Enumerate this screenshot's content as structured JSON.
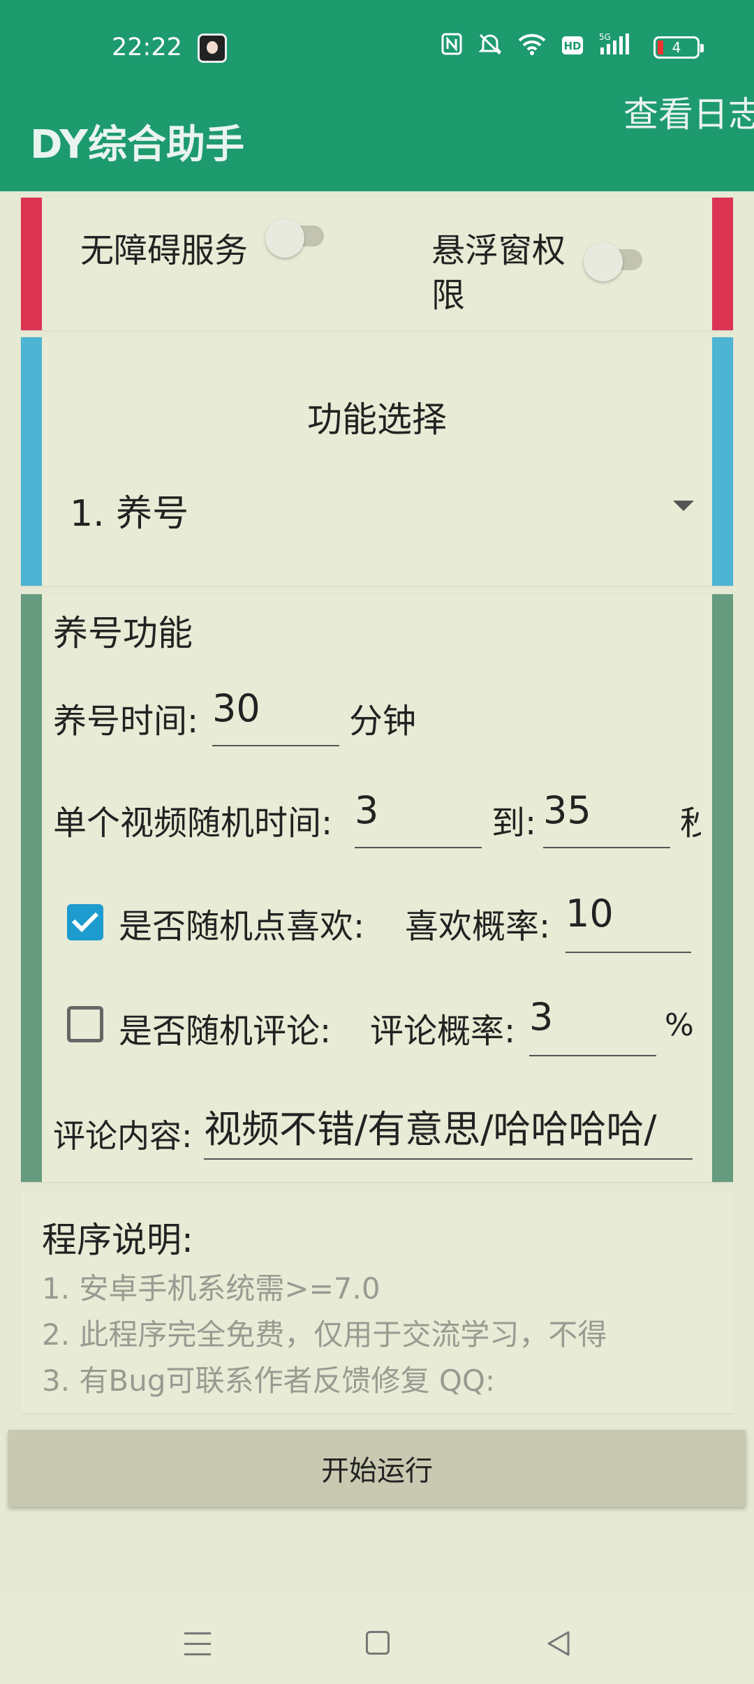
{
  "status_bar": {
    "time": "22:22",
    "icons": [
      "nfc-icon",
      "mute-icon",
      "wifi-icon",
      "hd-icon",
      "signal-5g-icon"
    ],
    "battery": "4"
  },
  "app_bar": {
    "title": "DY综合助手",
    "log_button": "查看日志"
  },
  "colors": {
    "primary": "#1e9a6f",
    "permission_accent": "#dc3352",
    "function_accent": "#4db4d4",
    "nurture_accent": "#669b7e",
    "checkbox_checked": "#1e9bcf"
  },
  "permissions": {
    "accessibility_label": "无障碍服务",
    "accessibility_on": false,
    "overlay_label_line1": "悬浮窗权",
    "overlay_label_line2": "限",
    "overlay_on": false
  },
  "function_select": {
    "title": "功能选择",
    "selected": "1. 养号"
  },
  "nurture": {
    "title": "养号功能",
    "time_label": "养号时间:",
    "time_value": "30",
    "time_unit": "分钟",
    "video_time_label": "单个视频随机时间:",
    "video_time_min": "3",
    "to_label": "到:",
    "video_time_max": "35",
    "video_time_unit": "秒",
    "random_like_label": "是否随机点喜欢:",
    "random_like_checked": true,
    "like_rate_label": "喜欢概率:",
    "like_rate_value": "10",
    "random_comment_label": "是否随机评论:",
    "random_comment_checked": false,
    "comment_rate_label": "评论概率:",
    "comment_rate_value": "3",
    "percent": "%",
    "comment_content_label": "评论内容:",
    "comment_content_value": "视频不错/有意思/哈哈哈哈/"
  },
  "description": {
    "title": "程序说明:",
    "lines": [
      "1. 安卓手机系统需>=7.0",
      "2. 此程序完全免费，仅用于交流学习，不得",
      "3. 有Bug可联系作者反馈修复 QQ:"
    ]
  },
  "start_button": "开始运行"
}
